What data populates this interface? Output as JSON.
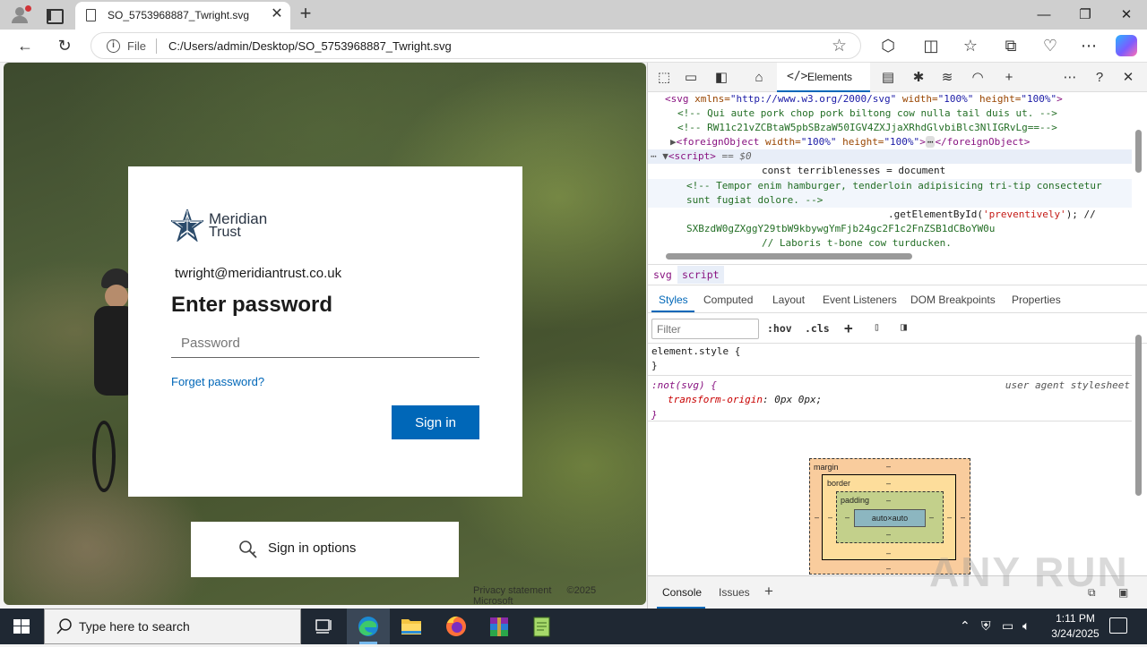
{
  "browser": {
    "tab_title": "SO_5753968887_Twright.svg",
    "close_glyph": "✕",
    "new_tab_glyph": "+",
    "file_label": "File",
    "url": "C:/Users/admin/Desktop/SO_5753968887_Twright.svg",
    "window_controls": {
      "minimize": "—",
      "maximize": "❐",
      "close": "✕"
    }
  },
  "signin": {
    "logo_line1": "Meridian",
    "logo_line2": "Trust",
    "email": "twright@meridiantrust.co.uk",
    "heading": "Enter password",
    "password_placeholder": "Password",
    "forgot_link": "Forget password?",
    "sign_in_button": "Sign in",
    "sign_in_options": "Sign in options",
    "footer_privacy": "Privacy statement",
    "footer_copyright": "©2025 Microsoft"
  },
  "devtools": {
    "elements_tab": "Elements",
    "dom_lines": {
      "l1_tag": "<svg",
      "l1_attrs": " xmlns=",
      "l1_xmlns": "\"http://www.w3.org/2000/svg\"",
      "l1_w": " width=",
      "l1_wv": "\"100%\"",
      "l1_h": " height=",
      "l1_hv": "\"100%\"",
      "l1_end": ">",
      "l2": "<!-- Qui aute pork chop pork biltong cow nulla tail duis ut. -->",
      "l3": "<!-- RW11c21vZCBtaW5pbSBzaW50IGV4ZXJjaXRhdGlvbiBlc3NlIGRvLg==-->",
      "l4_open": "<foreignObject",
      "l4_w": " width=",
      "l4_wv": "\"100%\"",
      "l4_h": " height=",
      "l4_hv": "\"100%\"",
      "l4_gt": ">",
      "l4_dots": "⋯",
      "l4_close": "</foreignObject>",
      "l5_tag": "<script>",
      "l5_eq": " == $0",
      "l6": "const terriblenesses = document",
      "l7": "<!-- Tempor enim hamburger, tenderloin adipisicing tri-tip consectetur",
      "l8": "sunt fugiat dolore. -->",
      "l9_a": ".getElementById(",
      "l9_str": "'preventively'",
      "l9_b": "); //",
      "l10": "SXBzdW0gZXggY29tbW9kbywgYmFjb24gc2F1c2FnZSB1dCBoYW0u",
      "l11": "// Laboris t-bone cow turducken."
    },
    "breadcrumbs": [
      "svg",
      "script"
    ],
    "subtabs": [
      "Styles",
      "Computed",
      "Layout",
      "Event Listeners",
      "DOM Breakpoints",
      "Properties"
    ],
    "filter_placeholder": "Filter",
    "hov": ":hov",
    "cls": ".cls",
    "style_rules": {
      "element_style": "element.style {",
      "close_brace": "}",
      "selector": ":not(svg) {",
      "ua_label": "user agent stylesheet",
      "prop_name": "transform-origin",
      "prop_value": ": 0px 0px;"
    },
    "box_model": {
      "margin": "margin",
      "border": "border",
      "padding": "padding",
      "content": "auto×auto",
      "dash": "–"
    },
    "drawer_tabs": [
      "Console",
      "Issues"
    ],
    "drawer_add": "+"
  },
  "watermark": "ANY RUN",
  "taskbar": {
    "search_placeholder": "Type here to search",
    "time": "1:11 PM",
    "date": "3/24/2025"
  }
}
